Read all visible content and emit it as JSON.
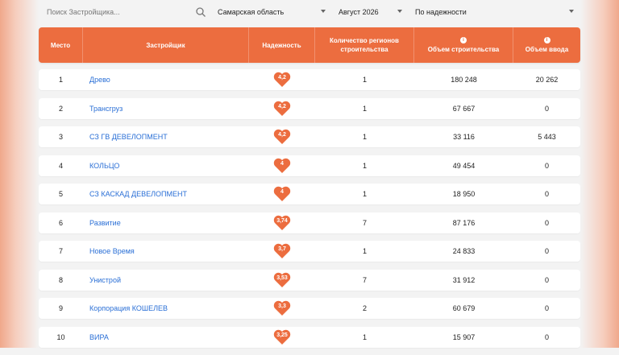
{
  "filters": {
    "search_placeholder": "Поиск Застройщика...",
    "region": "Самарская область",
    "date": "Август 2026",
    "sort": "По надежности"
  },
  "columns": {
    "place": "Место",
    "developer": "Застройщик",
    "reliability": "Надежность",
    "regions_line1": "Количество регионов",
    "regions_line2": "строительства",
    "construction_volume": "Объем строительства",
    "commissioning_volume": "Объем ввода",
    "info_icon": "i"
  },
  "colors": {
    "accent": "#ec6d3f",
    "link": "#2a6fd6"
  },
  "icons": {
    "search": "search-icon",
    "heart": "heart-icon",
    "info": "info-icon",
    "chevron": "chevron-down-icon"
  },
  "rows": [
    {
      "place": "1",
      "name": "Древо",
      "rating": "4,2",
      "regions": "1",
      "construction": "180 248",
      "commissioning": "20 262"
    },
    {
      "place": "2",
      "name": "Трансгруз",
      "rating": "4,2",
      "regions": "1",
      "construction": "67 667",
      "commissioning": "0"
    },
    {
      "place": "3",
      "name": "СЗ ГВ ДЕВЕЛОПМЕНТ",
      "rating": "4,2",
      "regions": "1",
      "construction": "33 116",
      "commissioning": "5 443"
    },
    {
      "place": "4",
      "name": "КОЛЬЦО",
      "rating": "4",
      "regions": "1",
      "construction": "49 454",
      "commissioning": "0"
    },
    {
      "place": "5",
      "name": "СЗ КАСКАД ДЕВЕЛОПМЕНТ",
      "rating": "4",
      "regions": "1",
      "construction": "18 950",
      "commissioning": "0"
    },
    {
      "place": "6",
      "name": "Развитие",
      "rating": "3,74",
      "regions": "7",
      "construction": "87 176",
      "commissioning": "0"
    },
    {
      "place": "7",
      "name": "Новое Время",
      "rating": "3,7",
      "regions": "1",
      "construction": "24 833",
      "commissioning": "0"
    },
    {
      "place": "8",
      "name": "Унистрой",
      "rating": "3,53",
      "regions": "7",
      "construction": "31 912",
      "commissioning": "0"
    },
    {
      "place": "9",
      "name": "Корпорация КОШЕЛЕВ",
      "rating": "3,3",
      "regions": "2",
      "construction": "60 679",
      "commissioning": "0"
    },
    {
      "place": "10",
      "name": "ВИРА",
      "rating": "3,25",
      "regions": "1",
      "construction": "15 907",
      "commissioning": "0"
    }
  ]
}
